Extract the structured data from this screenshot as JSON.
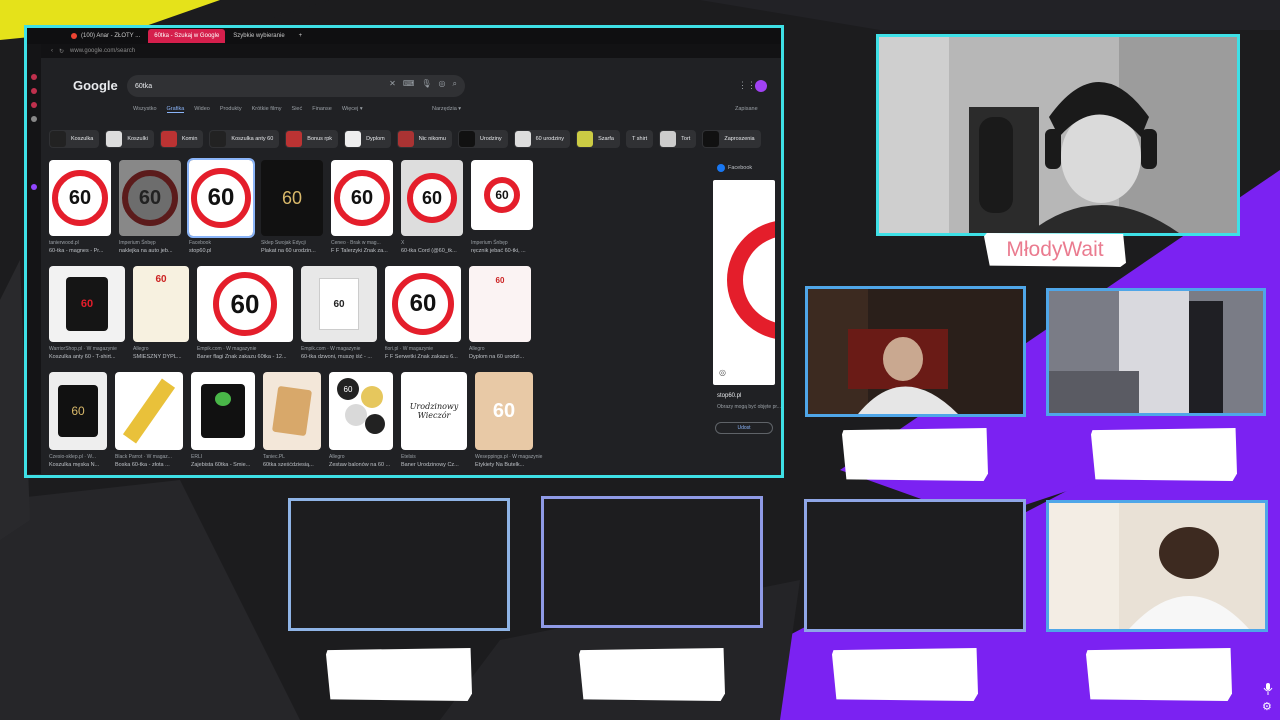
{
  "browser": {
    "tabs": [
      {
        "label": "(100) Anar - ZŁOTY ..."
      },
      {
        "label": "60tka - Szukaj w Google"
      },
      {
        "label": "Szybkie wybieranie"
      }
    ],
    "url": "www.google.com/search",
    "logo": "Google",
    "query": "60tka",
    "filters": [
      "Wszystko",
      "Grafika",
      "Wideo",
      "Produkty",
      "Krótkie filmy",
      "Sieć",
      "Finanse",
      "Więcej ▾"
    ],
    "tools": "Narzędzia ▾",
    "saved": "Zapisane",
    "chips": [
      "Koszulka",
      "Koszulki",
      "Komin",
      "Koszulka anty 60",
      "Bonus rpk",
      "Dyplom",
      "Nic nikomu",
      "Urodziny",
      "60 urodziny",
      "Szarfa",
      "T shirt",
      "Tort",
      "Zaproszenia"
    ],
    "rows": [
      [
        {
          "src": "tanierwood.pl",
          "title": "60-tka - magnes - Pr..."
        },
        {
          "src": "Imperium Śnbęp",
          "title": "naklejka na auto jeb..."
        },
        {
          "src": "Facebook",
          "title": "stop60.pl"
        },
        {
          "src": "Sklep Swojak Edycji",
          "title": "Plakat na 60 urodzin..."
        },
        {
          "src": "Ceneo · Brak w mag...",
          "title": "F F Talerzyki Znak za..."
        },
        {
          "src": "X",
          "title": "60-tka Cord (@60_tk..."
        },
        {
          "src": "Imperium Śnbęp",
          "title": "ręcznik jebać 60-tki, ..."
        }
      ],
      [
        {
          "src": "WarriorShop.pl · W magazynie",
          "title": "Koszulka anty 60 - T-shirt..."
        },
        {
          "src": "Allegro",
          "title": "ŚMIESZNY DYPL..."
        },
        {
          "src": "Empik.com · W magazynie",
          "title": "Baner flagi Znak zakazu 60tka - 12..."
        },
        {
          "src": "Empik.com · W magazynie",
          "title": "60-tka dzwoni, muszę iść - ..."
        },
        {
          "src": "fiori.pl · W magazynie",
          "title": "F F Serwetki Znak zakazu 6..."
        },
        {
          "src": "Allegro",
          "title": "Dyplom na 60 urodzi..."
        }
      ],
      [
        {
          "src": "Czesio-sklep.pl · W...",
          "title": "Koszulka męska N..."
        },
        {
          "src": "Black Parrot · W magaz...",
          "title": "Boska 60-tka - złota ..."
        },
        {
          "src": "ERLI",
          "title": "Zajebista 60tka - Śmie..."
        },
        {
          "src": "Taniec.PL",
          "title": "60tka sześćdziesią..."
        },
        {
          "src": "Allegro",
          "title": "Zestaw balonów na 60 ..."
        },
        {
          "src": "Etelsis",
          "title": "Baner Urodzinowy Cz..."
        },
        {
          "src": "Weseppings.pl · W magazynie",
          "title": "Etykiety Na Butelk..."
        }
      ]
    ],
    "sign_text": "60",
    "banner_text": "Urodzinowy Wieczór",
    "side_panel": {
      "source": "Facebook",
      "title": "stop60.pl",
      "note": "Obrazy mogą być objęte pr...",
      "share": "Udost"
    }
  },
  "overlay": {
    "streamer_name": "MłodyWait",
    "accent": "#3ee0e6",
    "purple": "#7b22f2"
  }
}
